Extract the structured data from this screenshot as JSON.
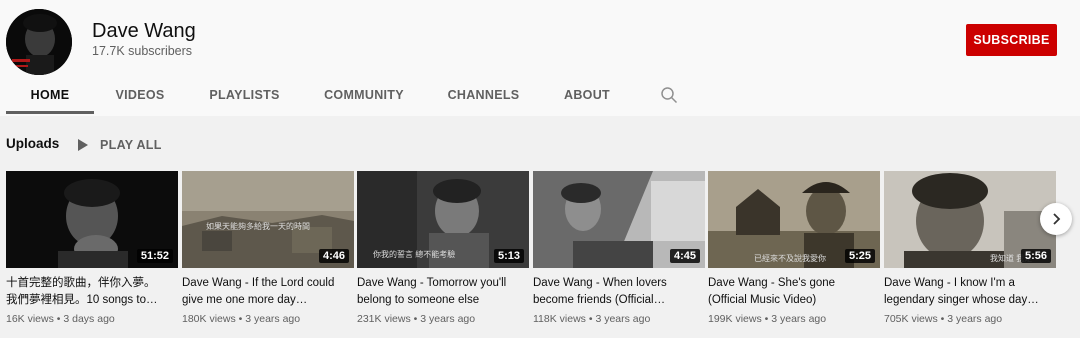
{
  "channel": {
    "name": "Dave Wang",
    "subscribers": "17.7K subscribers",
    "subscribe_label": "SUBSCRIBE",
    "subscribe_color": "#cc0000"
  },
  "tabs": [
    {
      "label": "HOME",
      "active": true
    },
    {
      "label": "VIDEOS",
      "active": false
    },
    {
      "label": "PLAYLISTS",
      "active": false
    },
    {
      "label": "COMMUNITY",
      "active": false
    },
    {
      "label": "CHANNELS",
      "active": false
    },
    {
      "label": "ABOUT",
      "active": false
    }
  ],
  "search_icon": "search-icon",
  "shelf": {
    "title": "Uploads",
    "play_all_label": "PLAY ALL"
  },
  "videos": [
    {
      "duration": "51:52",
      "title_line1": "十首完整的歌曲，伴你入夢。",
      "title_line2": "我們夢裡相見。10 songs to…",
      "views": "16K views",
      "age": "3 days ago"
    },
    {
      "duration": "4:46",
      "title_line1": "Dave Wang - If the Lord could",
      "title_line2": "give me one more day…",
      "views": "180K views",
      "age": "3 years ago",
      "caption": "如果天能夠多給我一天的時間"
    },
    {
      "duration": "5:13",
      "title_line1": "Dave Wang - Tomorrow you'll",
      "title_line2": "belong to someone else",
      "views": "231K views",
      "age": "3 years ago",
      "caption": "你我的誓言  總不能考驗"
    },
    {
      "duration": "4:45",
      "title_line1": "Dave Wang - When lovers",
      "title_line2": "become friends (Official…",
      "views": "118K views",
      "age": "3 years ago"
    },
    {
      "duration": "5:25",
      "title_line1": "Dave Wang - She's gone",
      "title_line2": "(Official Music Video)",
      "views": "199K views",
      "age": "3 years ago",
      "caption": "已經來不及說我愛你"
    },
    {
      "duration": "5:56",
      "title_line1": "Dave Wang - I know I'm a",
      "title_line2": "legendary singer whose day…",
      "views": "705K views",
      "age": "3 years ago",
      "caption": "我知道 我是"
    }
  ],
  "meta_separator": " • ",
  "next_icon": "chevron-right-icon"
}
